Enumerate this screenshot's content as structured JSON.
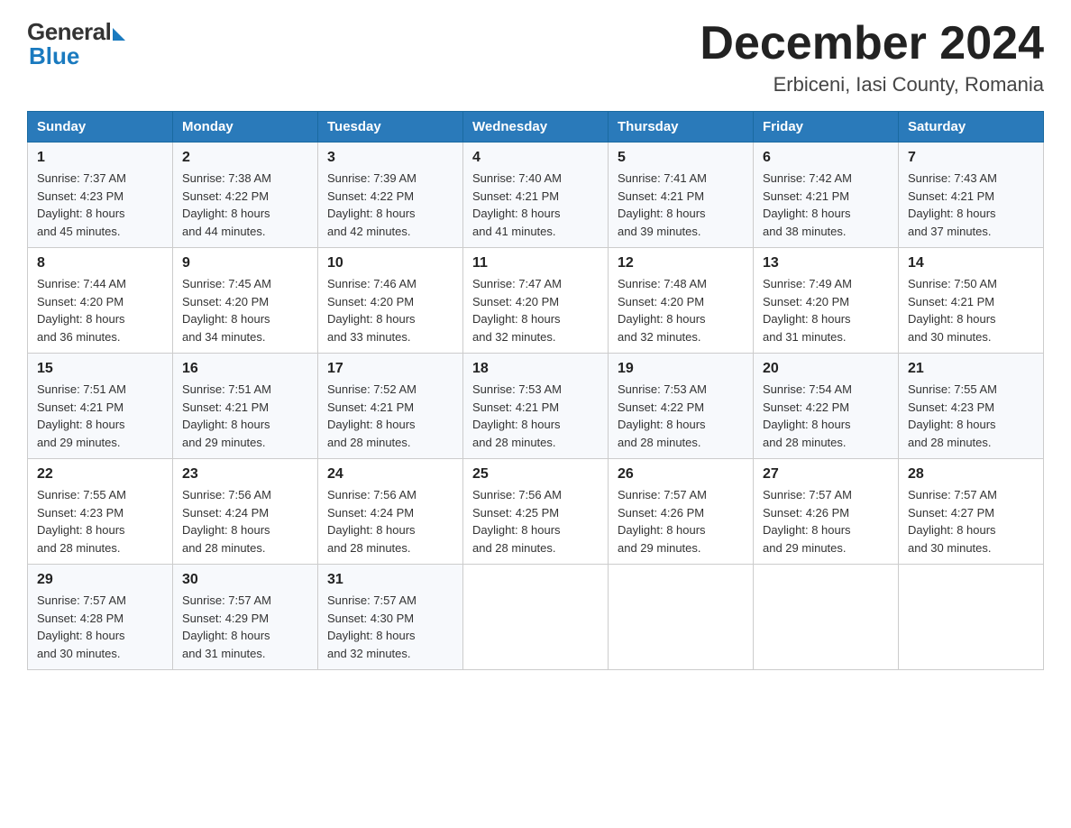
{
  "logo": {
    "general": "General",
    "blue": "Blue"
  },
  "title": {
    "month_year": "December 2024",
    "location": "Erbiceni, Iasi County, Romania"
  },
  "headers": [
    "Sunday",
    "Monday",
    "Tuesday",
    "Wednesday",
    "Thursday",
    "Friday",
    "Saturday"
  ],
  "weeks": [
    [
      {
        "num": "1",
        "sunrise": "7:37 AM",
        "sunset": "4:23 PM",
        "daylight": "8 hours and 45 minutes."
      },
      {
        "num": "2",
        "sunrise": "7:38 AM",
        "sunset": "4:22 PM",
        "daylight": "8 hours and 44 minutes."
      },
      {
        "num": "3",
        "sunrise": "7:39 AM",
        "sunset": "4:22 PM",
        "daylight": "8 hours and 42 minutes."
      },
      {
        "num": "4",
        "sunrise": "7:40 AM",
        "sunset": "4:21 PM",
        "daylight": "8 hours and 41 minutes."
      },
      {
        "num": "5",
        "sunrise": "7:41 AM",
        "sunset": "4:21 PM",
        "daylight": "8 hours and 39 minutes."
      },
      {
        "num": "6",
        "sunrise": "7:42 AM",
        "sunset": "4:21 PM",
        "daylight": "8 hours and 38 minutes."
      },
      {
        "num": "7",
        "sunrise": "7:43 AM",
        "sunset": "4:21 PM",
        "daylight": "8 hours and 37 minutes."
      }
    ],
    [
      {
        "num": "8",
        "sunrise": "7:44 AM",
        "sunset": "4:20 PM",
        "daylight": "8 hours and 36 minutes."
      },
      {
        "num": "9",
        "sunrise": "7:45 AM",
        "sunset": "4:20 PM",
        "daylight": "8 hours and 34 minutes."
      },
      {
        "num": "10",
        "sunrise": "7:46 AM",
        "sunset": "4:20 PM",
        "daylight": "8 hours and 33 minutes."
      },
      {
        "num": "11",
        "sunrise": "7:47 AM",
        "sunset": "4:20 PM",
        "daylight": "8 hours and 32 minutes."
      },
      {
        "num": "12",
        "sunrise": "7:48 AM",
        "sunset": "4:20 PM",
        "daylight": "8 hours and 32 minutes."
      },
      {
        "num": "13",
        "sunrise": "7:49 AM",
        "sunset": "4:20 PM",
        "daylight": "8 hours and 31 minutes."
      },
      {
        "num": "14",
        "sunrise": "7:50 AM",
        "sunset": "4:21 PM",
        "daylight": "8 hours and 30 minutes."
      }
    ],
    [
      {
        "num": "15",
        "sunrise": "7:51 AM",
        "sunset": "4:21 PM",
        "daylight": "8 hours and 29 minutes."
      },
      {
        "num": "16",
        "sunrise": "7:51 AM",
        "sunset": "4:21 PM",
        "daylight": "8 hours and 29 minutes."
      },
      {
        "num": "17",
        "sunrise": "7:52 AM",
        "sunset": "4:21 PM",
        "daylight": "8 hours and 28 minutes."
      },
      {
        "num": "18",
        "sunrise": "7:53 AM",
        "sunset": "4:21 PM",
        "daylight": "8 hours and 28 minutes."
      },
      {
        "num": "19",
        "sunrise": "7:53 AM",
        "sunset": "4:22 PM",
        "daylight": "8 hours and 28 minutes."
      },
      {
        "num": "20",
        "sunrise": "7:54 AM",
        "sunset": "4:22 PM",
        "daylight": "8 hours and 28 minutes."
      },
      {
        "num": "21",
        "sunrise": "7:55 AM",
        "sunset": "4:23 PM",
        "daylight": "8 hours and 28 minutes."
      }
    ],
    [
      {
        "num": "22",
        "sunrise": "7:55 AM",
        "sunset": "4:23 PM",
        "daylight": "8 hours and 28 minutes."
      },
      {
        "num": "23",
        "sunrise": "7:56 AM",
        "sunset": "4:24 PM",
        "daylight": "8 hours and 28 minutes."
      },
      {
        "num": "24",
        "sunrise": "7:56 AM",
        "sunset": "4:24 PM",
        "daylight": "8 hours and 28 minutes."
      },
      {
        "num": "25",
        "sunrise": "7:56 AM",
        "sunset": "4:25 PM",
        "daylight": "8 hours and 28 minutes."
      },
      {
        "num": "26",
        "sunrise": "7:57 AM",
        "sunset": "4:26 PM",
        "daylight": "8 hours and 29 minutes."
      },
      {
        "num": "27",
        "sunrise": "7:57 AM",
        "sunset": "4:26 PM",
        "daylight": "8 hours and 29 minutes."
      },
      {
        "num": "28",
        "sunrise": "7:57 AM",
        "sunset": "4:27 PM",
        "daylight": "8 hours and 30 minutes."
      }
    ],
    [
      {
        "num": "29",
        "sunrise": "7:57 AM",
        "sunset": "4:28 PM",
        "daylight": "8 hours and 30 minutes."
      },
      {
        "num": "30",
        "sunrise": "7:57 AM",
        "sunset": "4:29 PM",
        "daylight": "8 hours and 31 minutes."
      },
      {
        "num": "31",
        "sunrise": "7:57 AM",
        "sunset": "4:30 PM",
        "daylight": "8 hours and 32 minutes."
      },
      null,
      null,
      null,
      null
    ]
  ],
  "labels": {
    "sunrise": "Sunrise:",
    "sunset": "Sunset:",
    "daylight": "Daylight:"
  }
}
